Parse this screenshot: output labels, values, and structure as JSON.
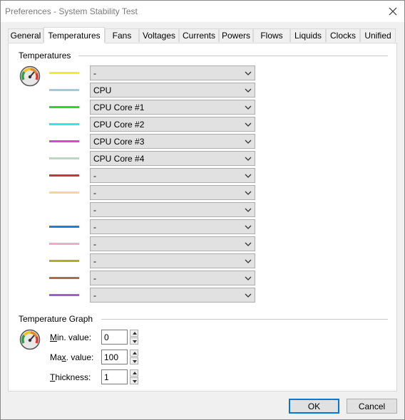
{
  "window": {
    "title": "Preferences - System Stability Test"
  },
  "tabs": [
    {
      "label": "General"
    },
    {
      "label": "Temperatures"
    },
    {
      "label": "Fans"
    },
    {
      "label": "Voltages"
    },
    {
      "label": "Currents"
    },
    {
      "label": "Powers"
    },
    {
      "label": "Flows"
    },
    {
      "label": "Liquids"
    },
    {
      "label": "Clocks"
    },
    {
      "label": "Unified"
    }
  ],
  "active_tab": "Temperatures",
  "temperatures": {
    "group_label": "Temperatures",
    "rows": [
      {
        "color": "#f0f020",
        "value": "-"
      },
      {
        "color": "#a7c7dc",
        "value": "CPU"
      },
      {
        "color": "#22dd22",
        "value": "CPU Core #1"
      },
      {
        "color": "#33e5e5",
        "value": "CPU Core #2"
      },
      {
        "color": "#dd44dd",
        "value": "CPU Core #3"
      },
      {
        "color": "#bcd6c4",
        "value": "CPU Core #4"
      },
      {
        "color": "#cc3333",
        "value": "-"
      },
      {
        "color": "#f3d79a",
        "value": "-"
      },
      {
        "color": "#ffffff",
        "value": "-"
      },
      {
        "color": "#1e7fd6",
        "value": "-"
      },
      {
        "color": "#f1a9c7",
        "value": "-"
      },
      {
        "color": "#b0ad1e",
        "value": "-"
      },
      {
        "color": "#b06a45",
        "value": "-"
      },
      {
        "color": "#9b5fd6",
        "value": "-"
      }
    ]
  },
  "graph": {
    "group_label": "Temperature Graph",
    "min": {
      "label_pre": "M",
      "label_post": "in. value:",
      "value": "0"
    },
    "max": {
      "label_pre": "Ma",
      "label_u": "x",
      "label_post": ". value:",
      "value": "100"
    },
    "thickness": {
      "label_u": "T",
      "label_post": "hickness:",
      "value": "1"
    }
  },
  "buttons": {
    "ok": "OK",
    "cancel": "Cancel"
  }
}
